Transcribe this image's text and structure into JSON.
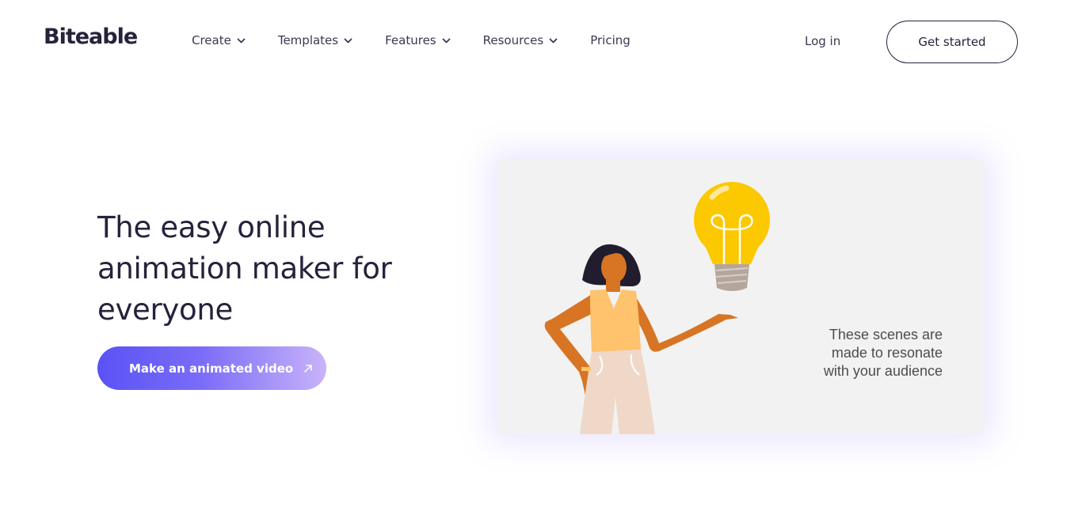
{
  "brand": {
    "name": "Biteable"
  },
  "nav": {
    "items": [
      {
        "label": "Create",
        "has_dropdown": true
      },
      {
        "label": "Templates",
        "has_dropdown": true
      },
      {
        "label": "Features",
        "has_dropdown": true
      },
      {
        "label": "Resources",
        "has_dropdown": true
      },
      {
        "label": "Pricing",
        "has_dropdown": false
      }
    ],
    "login_label": "Log in",
    "get_started_label": "Get started"
  },
  "hero": {
    "title": "The easy online animation maker for everyone",
    "cta_label": "Make an animated video",
    "cta_icon": "arrow-up-right-icon"
  },
  "scene": {
    "caption_lines": [
      "These scenes are",
      "made to resonate",
      "with your audience"
    ],
    "illustration": "woman-with-lightbulb",
    "colors": {
      "bulb": "#fcc800",
      "top": "#ffc36e",
      "skin": "#d77524",
      "pants": "#f0d8c8",
      "hair": "#221d2e",
      "background": "#f2f2f2"
    }
  },
  "colors": {
    "brand_dark": "#25233b",
    "cta_gradient_start": "#5a52f5",
    "cta_gradient_end": "#c9b3f9"
  }
}
